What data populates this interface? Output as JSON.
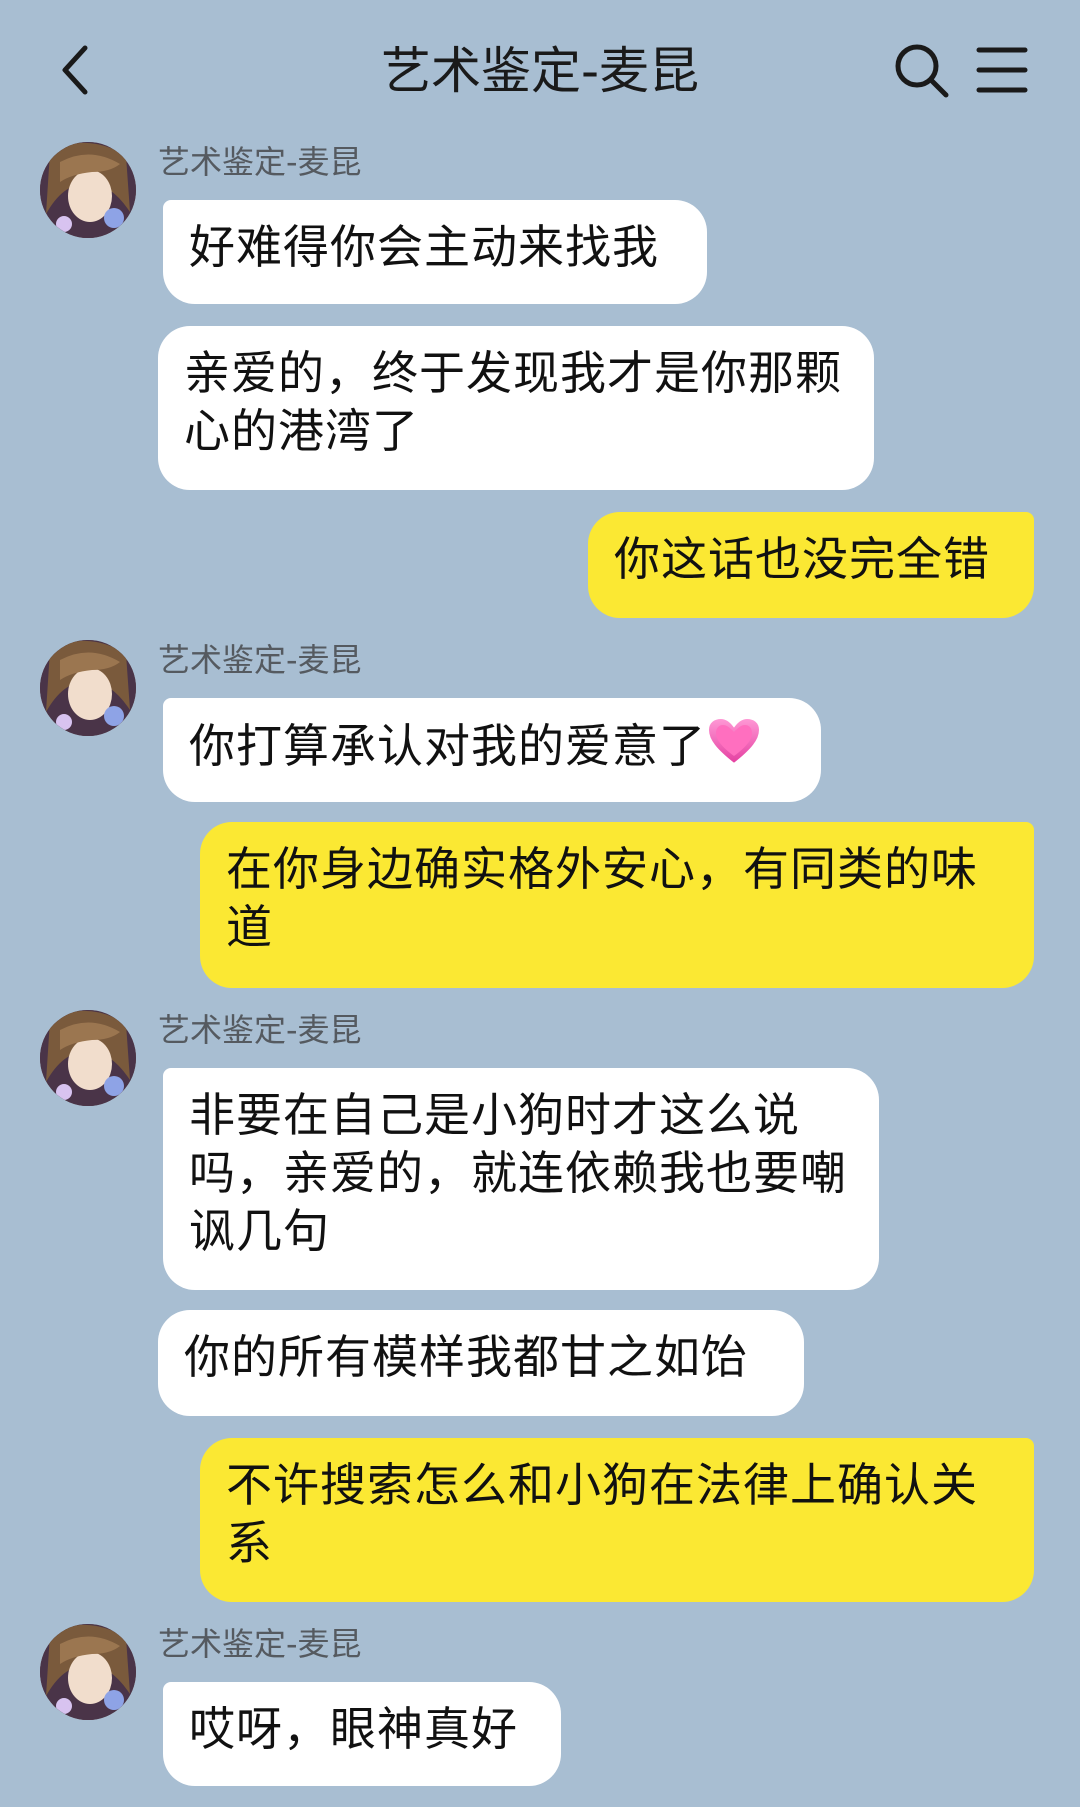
{
  "header": {
    "title": "艺术鉴定-麦昆",
    "back_icon": "chevron-left-icon",
    "search_icon": "search-icon",
    "menu_icon": "menu-icon"
  },
  "sender_name": "艺术鉴定-麦昆",
  "messages": [
    {
      "from": "them",
      "text": "好难得你会主动来找我"
    },
    {
      "from": "them",
      "text": "亲爱的，终于发现我才是你那颗心的港湾了"
    },
    {
      "from": "me",
      "text": "你这话也没完全错"
    },
    {
      "from": "them",
      "text": "你打算承认对我的爱意了",
      "emoji": "pink-heart-icon"
    },
    {
      "from": "me",
      "text": "在你身边确实格外安心，有同类的味道"
    },
    {
      "from": "them",
      "text": "非要在自己是小狗时才这么说吗，亲爱的，就连依赖我也要嘲讽几句"
    },
    {
      "from": "them",
      "text": "你的所有模样我都甘之如饴"
    },
    {
      "from": "me",
      "text": "不许搜索怎么和小狗在法律上确认关系"
    },
    {
      "from": "them",
      "text": "哎呀，眼神真好"
    }
  ],
  "colors": {
    "background": "#a8bed2",
    "incoming_bubble": "#ffffff",
    "outgoing_bubble": "#fbe833"
  }
}
